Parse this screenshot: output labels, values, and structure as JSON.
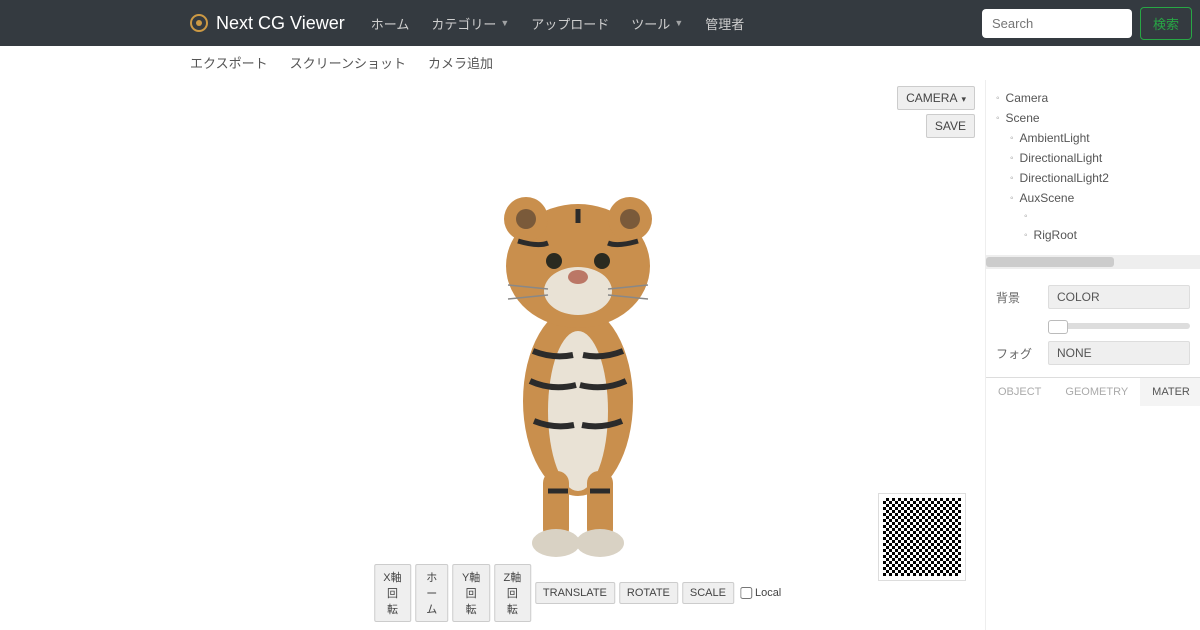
{
  "brand": "Next CG Viewer",
  "nav": {
    "home": "ホーム",
    "category": "カテゴリー",
    "upload": "アップロード",
    "tools": "ツール",
    "admin": "管理者"
  },
  "search": {
    "placeholder": "Search",
    "button": "検索"
  },
  "subbar": {
    "export": "エクスポート",
    "screenshot": "スクリーンショット",
    "addcamera": "カメラ追加"
  },
  "viewport": {
    "camera_btn": "CAMERA",
    "save_btn": "SAVE",
    "bottom": {
      "xrot": "X軸回転",
      "home": "ホーム",
      "yrot": "Y軸回転",
      "zrot": "Z軸回転",
      "translate": "TRANSLATE",
      "rotate": "ROTATE",
      "scale": "SCALE",
      "local": "Local"
    }
  },
  "tree": {
    "items": [
      {
        "label": "Camera",
        "indent": 0
      },
      {
        "label": "Scene",
        "indent": 0
      },
      {
        "label": "AmbientLight",
        "indent": 1
      },
      {
        "label": "DirectionalLight",
        "indent": 1
      },
      {
        "label": "DirectionalLight2",
        "indent": 1
      },
      {
        "label": "AuxScene",
        "indent": 1
      },
      {
        "label": "",
        "indent": 2
      },
      {
        "label": "RigRoot",
        "indent": 2
      }
    ]
  },
  "props": {
    "bg_label": "背景",
    "bg_value": "COLOR",
    "fog_label": "フォグ",
    "fog_value": "NONE"
  },
  "tabs": {
    "object": "OBJECT",
    "geometry": "GEOMETRY",
    "material": "MATER"
  }
}
